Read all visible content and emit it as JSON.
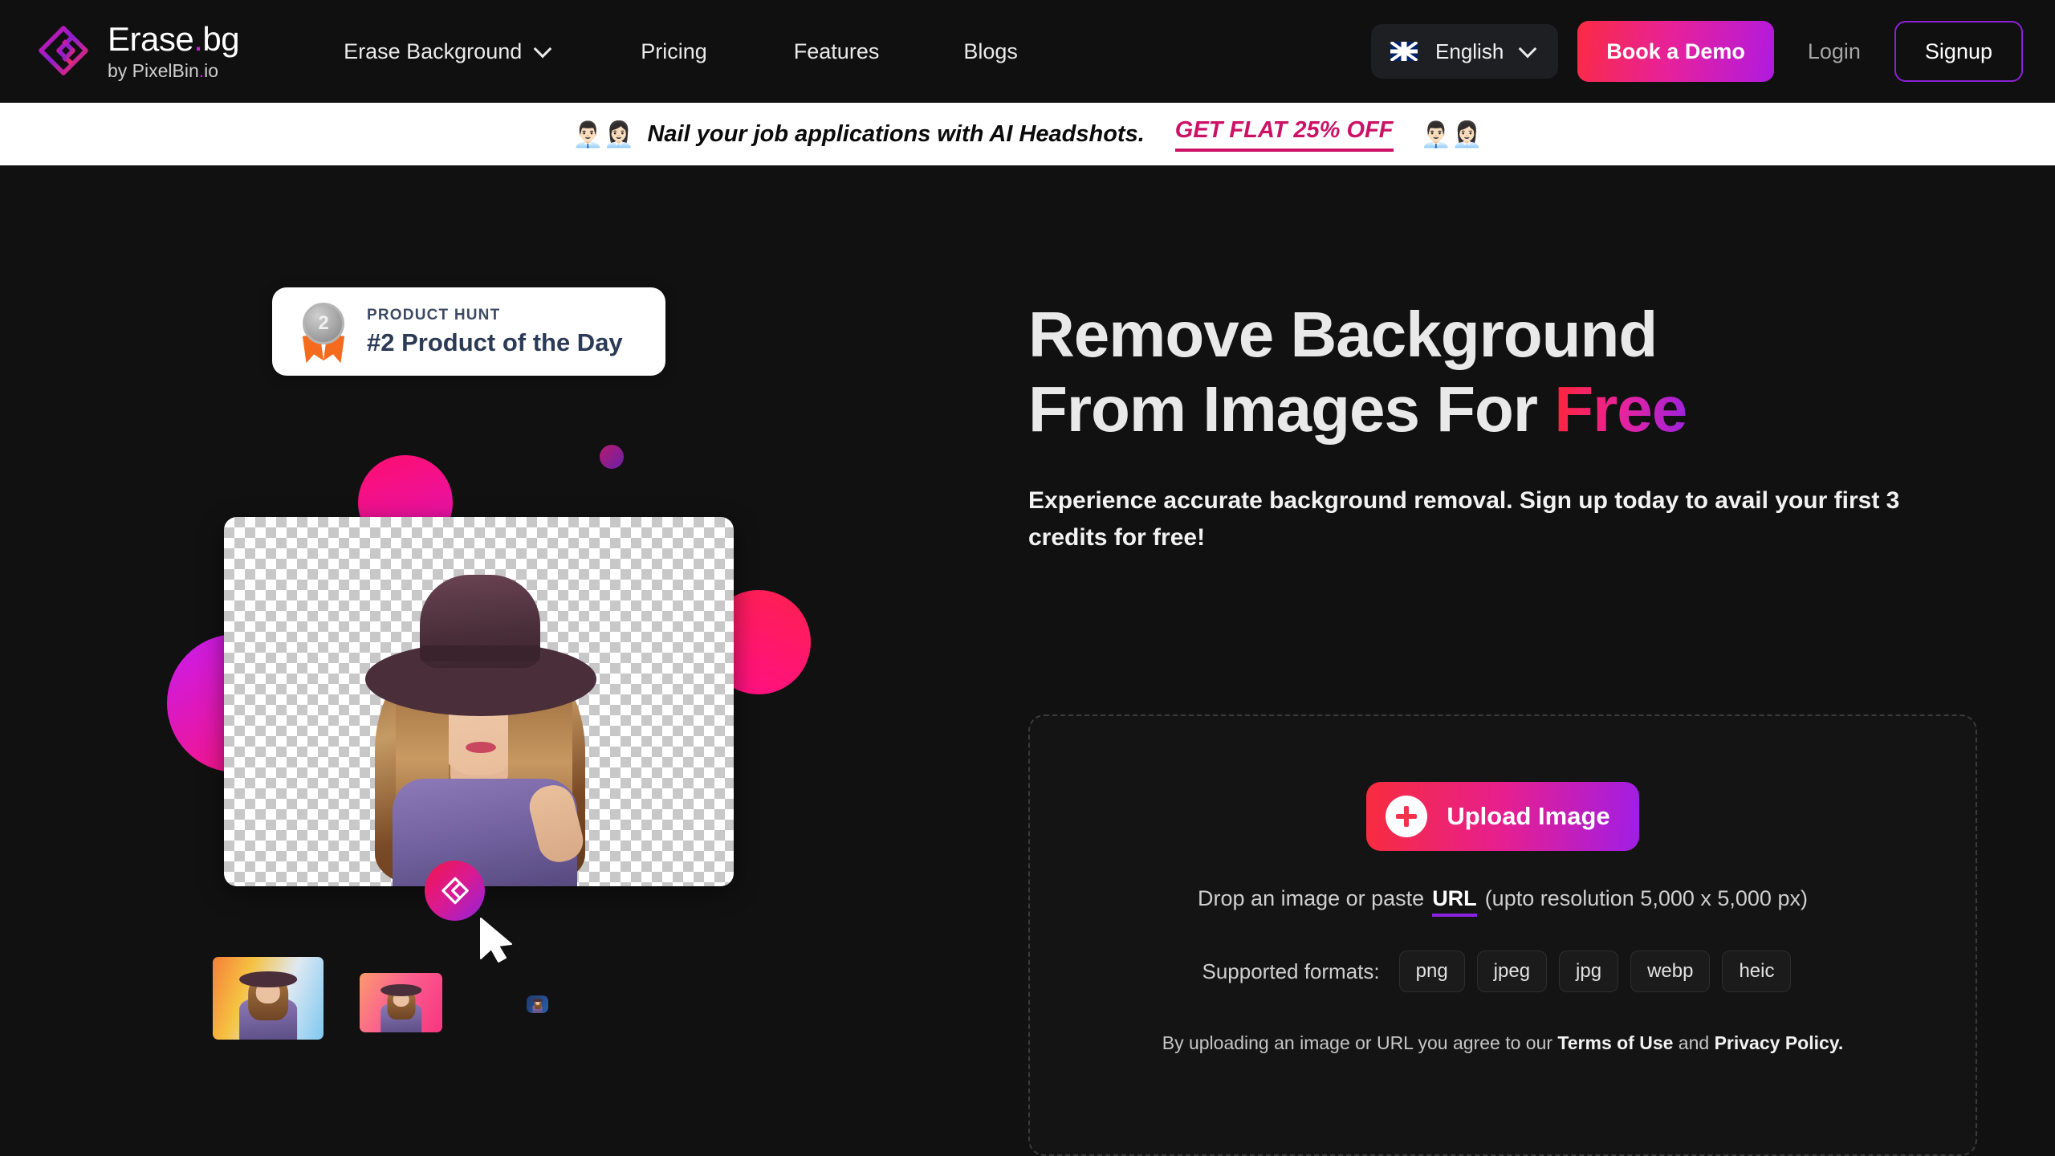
{
  "brand": {
    "name_main": "Erase",
    "name_dot": ".",
    "name_ext": "bg",
    "byline_pre": "by PixelBin",
    "byline_dot": ".",
    "byline_ext": "io",
    "logo_icon": "erase-bg-diamond-logo"
  },
  "nav": {
    "links": [
      {
        "label": "Erase Background",
        "has_chevron": true
      },
      {
        "label": "Pricing",
        "has_chevron": false
      },
      {
        "label": "Features",
        "has_chevron": false
      },
      {
        "label": "Blogs",
        "has_chevron": false
      }
    ],
    "language": {
      "label": "English",
      "flag": "uk-flag-icon",
      "chevron": "chevron-down-icon"
    },
    "demo_button": "Book a Demo",
    "login": "Login",
    "signup": "Signup"
  },
  "banner": {
    "emoji_left": "👨🏻‍💼👩🏻‍💼",
    "text": "Nail your job applications with AI Headshots.",
    "cta": "GET FLAT 25% OFF",
    "emoji_right": "👨🏻‍💼👩🏻‍💼",
    "cta_color": "#cc1166"
  },
  "product_hunt": {
    "kicker": "PRODUCT HUNT",
    "title": "#2 Product of the Day",
    "medal_rank": "2",
    "icon": "product-hunt-medal-icon"
  },
  "hero": {
    "heading_line1": "Remove Background",
    "heading_line2_plain": "From Images For ",
    "heading_line2_accent": "Free",
    "accent_gradient_from": "#ff2436",
    "accent_gradient_to": "#9c22e0",
    "subtitle": "Experience accurate background removal. Sign up today to avail your first 3 credits for free!"
  },
  "preview": {
    "fab_icon": "erase-bg-logo-icon",
    "cursor_icon": "cursor-arrow-icon",
    "thumbnails": [
      "thumbnail-large",
      "thumbnail-medium",
      "thumbnail-small"
    ]
  },
  "upload": {
    "button_label": "Upload Image",
    "plus_icon": "plus-icon",
    "drop_prefix": "Drop an image or paste",
    "drop_url_word": "URL",
    "drop_suffix": "(upto resolution 5,000 x 5,000 px)",
    "formats_label": "Supported formats:",
    "formats": [
      "png",
      "jpeg",
      "jpg",
      "webp",
      "heic"
    ],
    "terms_prefix": "By uploading an image or URL you agree to our ",
    "terms_link": "Terms of Use",
    "terms_middle": " and ",
    "privacy_link": "Privacy Policy.",
    "button_gradient_from": "#f82c3d",
    "button_gradient_to": "#a01ee6"
  }
}
